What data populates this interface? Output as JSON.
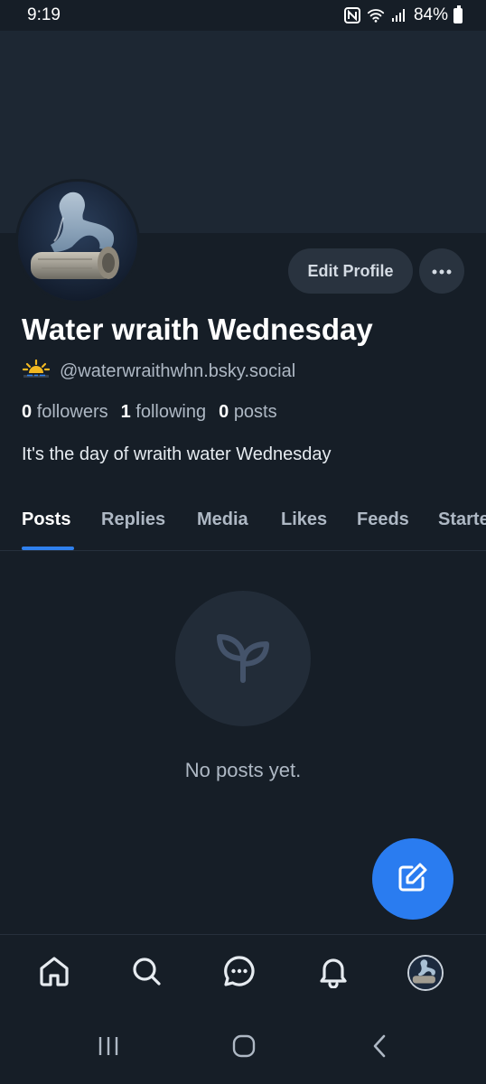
{
  "status_bar": {
    "time": "9:19",
    "battery": "84%",
    "icons": [
      "nfc-icon",
      "wifi-icon",
      "signal-icon",
      "battery-icon"
    ]
  },
  "profile": {
    "display_name": "Water wraith Wednesday",
    "handle": "@waterwraithwhn.bsky.social",
    "handle_emoji": "🌅",
    "followers_count": "0",
    "followers_label": "followers",
    "following_count": "1",
    "following_label": "following",
    "posts_count": "0",
    "posts_label": "posts",
    "bio": "It's the day of wraith water Wednesday"
  },
  "actions": {
    "edit_profile_label": "Edit Profile",
    "more_icon": "ellipsis-icon"
  },
  "tabs": [
    {
      "label": "Posts",
      "active": true
    },
    {
      "label": "Replies",
      "active": false
    },
    {
      "label": "Media",
      "active": false
    },
    {
      "label": "Likes",
      "active": false
    },
    {
      "label": "Feeds",
      "active": false
    },
    {
      "label": "Starte",
      "active": false
    }
  ],
  "empty_state": {
    "icon": "sprout-icon",
    "text": "No posts yet."
  },
  "fab": {
    "icon": "compose-icon"
  },
  "bottom_nav": [
    "home-icon",
    "search-icon",
    "chat-icon",
    "bell-icon",
    "profile-avatar"
  ],
  "system_nav": [
    "recents-icon",
    "home-circle-icon",
    "back-icon"
  ],
  "colors": {
    "background": "#161e27",
    "banner": "#1d2733",
    "accent": "#2f80ed",
    "fab": "#2a7cf0",
    "muted_text": "#aeb8c4"
  }
}
